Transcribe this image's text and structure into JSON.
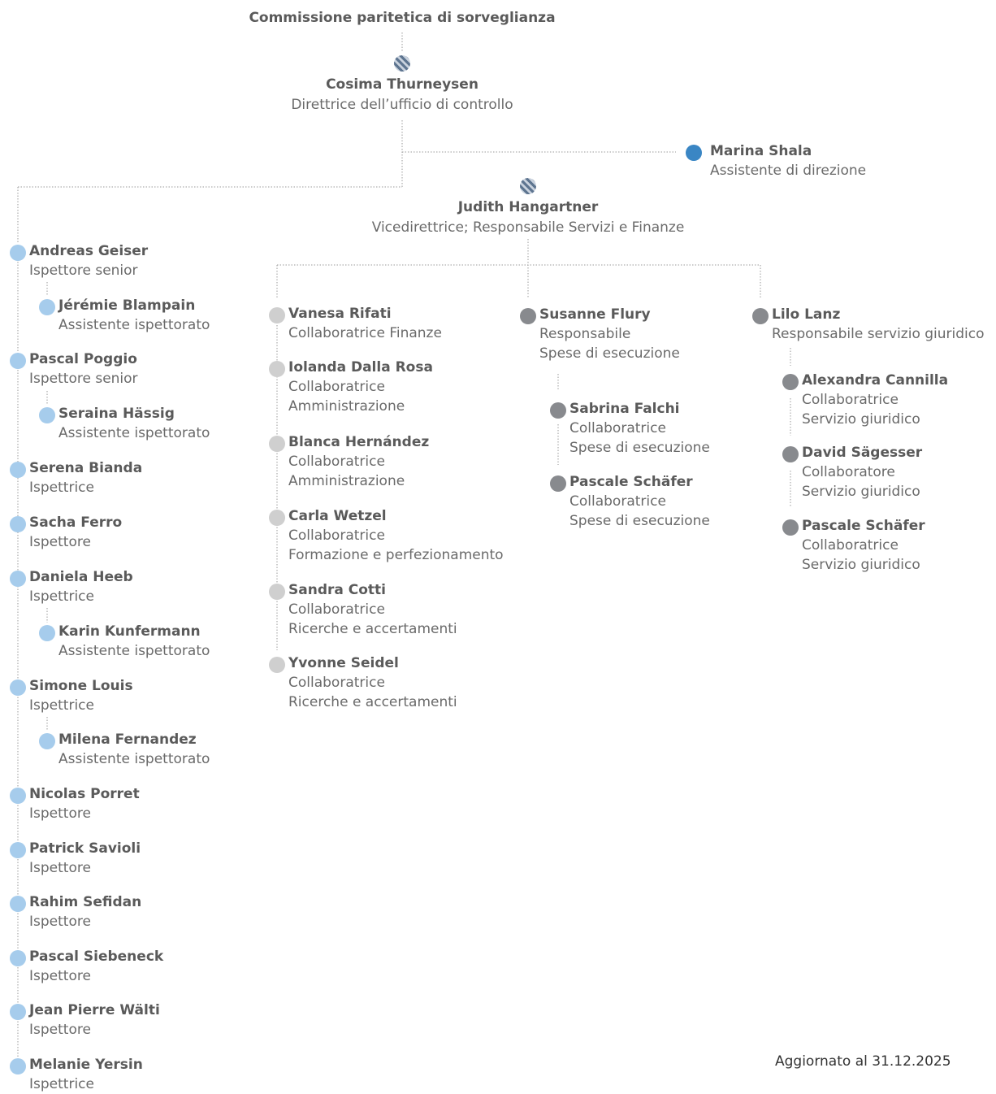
{
  "board": "Commissione paritetica di sorveglianza",
  "director": {
    "name": "Cosima Thurneysen",
    "role": "Direttrice dell’ufficio di controllo"
  },
  "assistant": {
    "name": "Marina Shala",
    "role": "Assistente di direzione"
  },
  "deputy": {
    "name": "Judith Hangartner",
    "role": "Vicedirettrice; Responsabile Servizi e Finanze"
  },
  "inspectorate": [
    {
      "name": "Andreas Geiser",
      "role": "Ispettore senior"
    },
    {
      "name": "Jérémie Blampain",
      "role": "Assistente ispettorato",
      "sub": true
    },
    {
      "name": "Pascal Poggio",
      "role": "Ispettore senior"
    },
    {
      "name": "Seraina Hässig",
      "role": "Assistente ispettorato",
      "sub": true
    },
    {
      "name": "Serena Bianda",
      "role": "Ispettrice"
    },
    {
      "name": "Sacha Ferro",
      "role": "Ispettore"
    },
    {
      "name": "Daniela Heeb",
      "role": "Ispettrice"
    },
    {
      "name": "Karin Kunfermann",
      "role": "Assistente ispettorato",
      "sub": true
    },
    {
      "name": "Simone Louis",
      "role": "Ispettrice"
    },
    {
      "name": "Milena Fernandez",
      "role": "Assistente ispettorato",
      "sub": true
    },
    {
      "name": "Nicolas Porret",
      "role": "Ispettore"
    },
    {
      "name": "Patrick Savioli",
      "role": "Ispettore"
    },
    {
      "name": "Rahim Sefidan",
      "role": "Ispettore"
    },
    {
      "name": "Pascal Siebeneck",
      "role": "Ispettore"
    },
    {
      "name": "Jean Pierre Wälti",
      "role": "Ispettore"
    },
    {
      "name": "Melanie Yersin",
      "role": "Ispettrice"
    }
  ],
  "services": [
    {
      "name": "Vanesa Rifati",
      "role": [
        "Collaboratrice Finanze"
      ]
    },
    {
      "name": "Iolanda Dalla Rosa",
      "role": [
        "Collaboratrice",
        "Amministrazione"
      ]
    },
    {
      "name": "Blanca Hernández",
      "role": [
        "Collaboratrice",
        "Amministrazione"
      ]
    },
    {
      "name": "Carla Wetzel",
      "role": [
        "Collaboratrice",
        "Formazione e perfezionamento"
      ]
    },
    {
      "name": "Sandra Cotti",
      "role": [
        "Collaboratrice",
        "Ricerche e accertamenti"
      ]
    },
    {
      "name": "Yvonne Seidel",
      "role": [
        "Collaboratrice",
        "Ricerche e accertamenti"
      ]
    }
  ],
  "enforcement": {
    "head": {
      "name": "Susanne Flury",
      "role": [
        "Responsabile",
        "Spese di esecuzione"
      ]
    },
    "members": [
      {
        "name": "Sabrina Falchi",
        "role": [
          "Collaboratrice",
          "Spese di esecuzione"
        ]
      },
      {
        "name": "Pascale Schäfer",
        "role": [
          "Collaboratrice",
          "Spese di esecuzione"
        ]
      }
    ]
  },
  "legal": {
    "head": {
      "name": "Lilo Lanz",
      "role": [
        "Responsabile servizio giuridico"
      ]
    },
    "members": [
      {
        "name": "Alexandra Cannilla",
        "role": [
          "Collaboratrice",
          "Servizio giuridico"
        ]
      },
      {
        "name": "David Sägesser",
        "role": [
          "Collaboratore",
          "Servizio giuridico"
        ]
      },
      {
        "name": "Pascale Schäfer",
        "role": [
          "Collaboratrice",
          "Servizio giuridico"
        ]
      }
    ]
  },
  "updated": "Aggiornato al 31.12.2025",
  "colors": {
    "inspectorate": "#a6ccec",
    "assistant": "#3a86c4",
    "services": "#cfcfcf",
    "teams": "#888a8e",
    "lines": "#9a9a9a"
  }
}
